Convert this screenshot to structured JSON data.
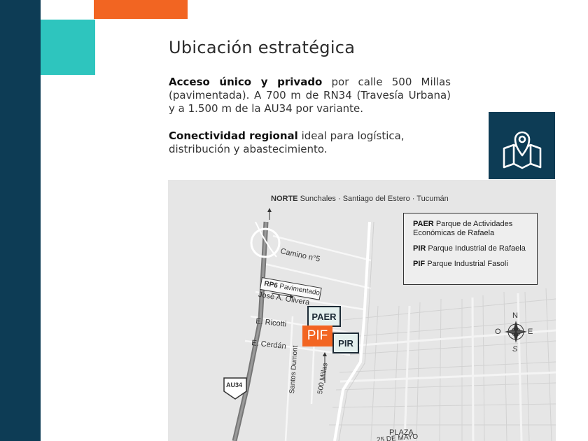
{
  "heading": "Ubicación estratégica",
  "access": {
    "bold": "Acceso único y privado",
    "text": " por calle 500 Millas (pavimentada). A 700 m de RN34 (Travesía Urbana) y a 1.500 m de la AU34 por variante."
  },
  "connectivity": {
    "bold": "Conectividad regional",
    "text": " ideal para logística, distribución y abastecimiento."
  },
  "icon": "map-pin-icon",
  "colors": {
    "navy": "#0d3c55",
    "teal": "#2ec5be",
    "orange": "#f26522"
  },
  "map": {
    "north_bold": "NORTE",
    "north_text": "Sunchales · Santiago del Estero · Tucumán",
    "legend": [
      {
        "code": "PAER",
        "name": "Parque de Actividades Económicas de Rafaela"
      },
      {
        "code": "PIR",
        "name": "Parque Industrial de Rafaela"
      },
      {
        "code": "PIF",
        "name": "Parque Industrial Fasoli"
      }
    ],
    "streets": {
      "camino": "Camino n°5",
      "rp6_bold": "RP6",
      "rp6_text": "Pavimentado",
      "olivera": "José A. Olivera",
      "ricotti": "E. Ricotti",
      "cerdan": "E. Cerdán",
      "dumont": "Santos Dumont",
      "millas": "500 Millas",
      "au34": "AU34",
      "plaza": "PLAZA",
      "plaza2": "25 DE MAYO"
    },
    "tags": {
      "paer": "PAER",
      "pif": "PIF",
      "pir": "PIR"
    },
    "compass": {
      "n": "N",
      "s": "S",
      "e": "E",
      "o": "O"
    }
  }
}
